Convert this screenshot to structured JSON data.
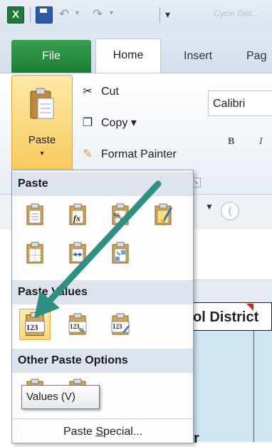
{
  "app": {
    "name": "Excel"
  },
  "quick_access": {
    "undo_arrow": "↶",
    "redo_arrow": "↷",
    "customize_glyph": "▾",
    "title_fragment": "Cycle Dist..."
  },
  "tabs": {
    "file": "File",
    "home": "Home",
    "insert": "Insert",
    "page_layout": "Pag"
  },
  "clipboard": {
    "paste_label": "Paste",
    "paste_caret": "▾",
    "cut": "Cut",
    "copy": "Copy ▾",
    "format_painter": "Format Painter"
  },
  "font": {
    "name": "Calibri",
    "bold": "B",
    "italic": "I"
  },
  "sheet": {
    "title_cell": "ol District",
    "bottom_text": "r"
  },
  "paste_menu": {
    "section_paste": "Paste",
    "section_values": "Paste Values",
    "section_other": "Other Paste Options",
    "paste_special": "Paste Special...",
    "paste_special_accel": "S",
    "paste_special_prefix": "Paste ",
    "paste_special_suffix": "pecial..."
  },
  "tooltip": {
    "text": "Values (V)"
  },
  "colors": {
    "file_tab": "#1e7d36",
    "arrow": "#2f8f83",
    "selected_bg": "#fbd77a",
    "section_bg": "#dde4ee"
  },
  "icons": {
    "paste_row1": [
      "paste-icon",
      "formulas-icon",
      "formulas-number-formatting-icon",
      "keep-source-formatting-icon"
    ],
    "paste_row2": [
      "no-borders-icon",
      "keep-column-widths-icon",
      "transpose-icon"
    ],
    "values_row": [
      "values-icon",
      "values-number-formatting-icon",
      "values-source-formatting-icon"
    ],
    "other_row": [
      "formatting-icon",
      "paste-link-icon"
    ]
  }
}
